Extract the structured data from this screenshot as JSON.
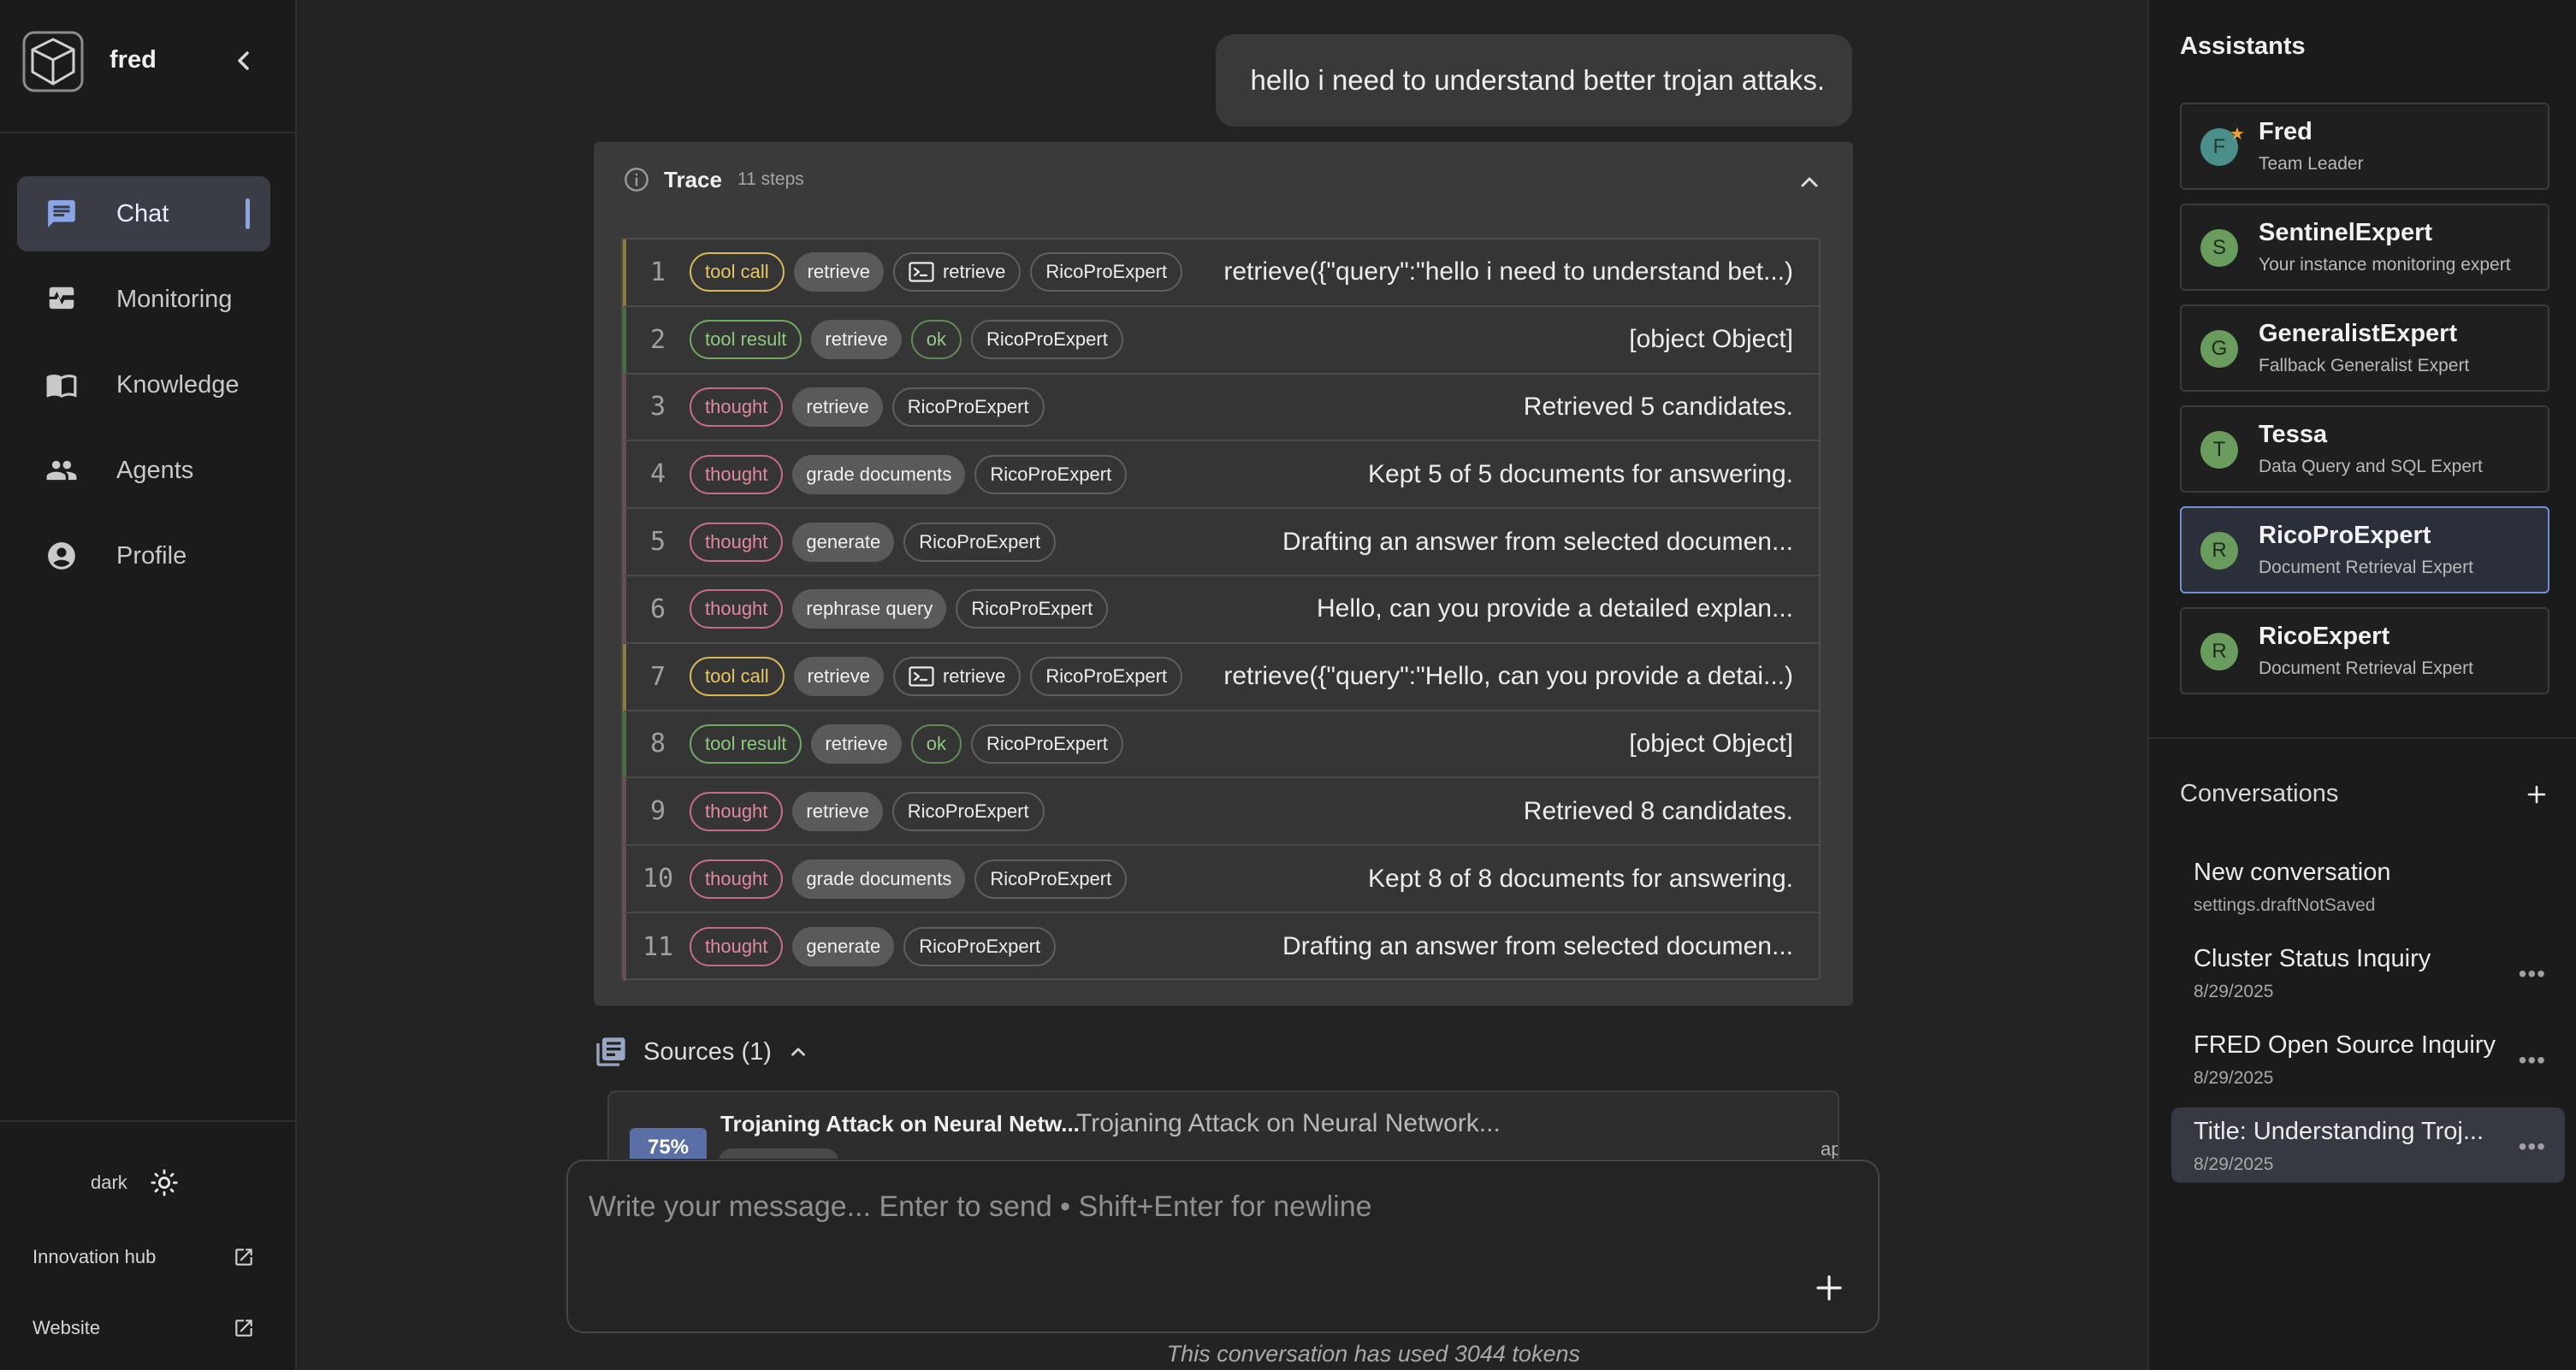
{
  "sidebar": {
    "brand": "fred",
    "nav": [
      {
        "label": "Chat",
        "icon": "chat-icon"
      },
      {
        "label": "Monitoring",
        "icon": "monitoring-icon"
      },
      {
        "label": "Knowledge",
        "icon": "book-icon"
      },
      {
        "label": "Agents",
        "icon": "people-icon"
      },
      {
        "label": "Profile",
        "icon": "account-icon"
      }
    ],
    "theme": "dark",
    "links": [
      {
        "label": "Innovation hub",
        "icon": "external-link-icon"
      },
      {
        "label": "Website",
        "icon": "external-link-icon"
      }
    ]
  },
  "chat": {
    "user_message": "hello i need to understand better trojan attaks.",
    "trace": {
      "title": "Trace",
      "steps_label": "11 steps",
      "rows": [
        {
          "n": "1",
          "kind": "tool call",
          "node": "retrieve",
          "tool": "retrieve",
          "agent": "RicoProExpert",
          "text": "retrieve({\"query\":\"hello i need to understand bet...)"
        },
        {
          "n": "2",
          "kind": "tool result",
          "node": "retrieve",
          "status": "ok",
          "agent": "RicoProExpert",
          "text": "[object Object]"
        },
        {
          "n": "3",
          "kind": "thought",
          "node": "retrieve",
          "agent": "RicoProExpert",
          "text": "Retrieved 5 candidates."
        },
        {
          "n": "4",
          "kind": "thought",
          "node": "grade documents",
          "agent": "RicoProExpert",
          "text": "Kept 5 of 5 documents for answering."
        },
        {
          "n": "5",
          "kind": "thought",
          "node": "generate",
          "agent": "RicoProExpert",
          "text": "Drafting an answer from selected documen..."
        },
        {
          "n": "6",
          "kind": "thought",
          "node": "rephrase query",
          "agent": "RicoProExpert",
          "text": "Hello, can you provide a detailed explan..."
        },
        {
          "n": "7",
          "kind": "tool call",
          "node": "retrieve",
          "tool": "retrieve",
          "agent": "RicoProExpert",
          "text": "retrieve({\"query\":\"Hello, can you provide a detai...)"
        },
        {
          "n": "8",
          "kind": "tool result",
          "node": "retrieve",
          "status": "ok",
          "agent": "RicoProExpert",
          "text": "[object Object]"
        },
        {
          "n": "9",
          "kind": "thought",
          "node": "retrieve",
          "agent": "RicoProExpert",
          "text": "Retrieved 8 candidates."
        },
        {
          "n": "10",
          "kind": "thought",
          "node": "grade documents",
          "agent": "RicoProExpert",
          "text": "Kept 8 of 8 documents for answering."
        },
        {
          "n": "11",
          "kind": "thought",
          "node": "generate",
          "agent": "RicoProExpert",
          "text": "Drafting an answer from selected documen..."
        }
      ]
    },
    "sources": {
      "label": "Sources (1)",
      "items": [
        {
          "score": "75%",
          "title": "Trojaning Attack on Neural Netw...",
          "snippet": "Trojaning Attack on Neural Network...",
          "mime": "application/pdf"
        }
      ]
    },
    "composer": {
      "placeholder": "Write your message...  Enter to send • Shift+Enter for newline"
    },
    "token_note": "This conversation has used 3044 tokens"
  },
  "right": {
    "assistants_title": "Assistants",
    "assistants": [
      {
        "initial": "F",
        "name": "Fred",
        "desc": "Team Leader"
      },
      {
        "initial": "S",
        "name": "SentinelExpert",
        "desc": "Your instance monitoring expert"
      },
      {
        "initial": "G",
        "name": "GeneralistExpert",
        "desc": "Fallback Generalist Expert"
      },
      {
        "initial": "T",
        "name": "Tessa",
        "desc": "Data Query and SQL Expert"
      },
      {
        "initial": "R",
        "name": "RicoProExpert",
        "desc": "Document Retrieval Expert"
      },
      {
        "initial": "R",
        "name": "RicoExpert",
        "desc": "Document Retrieval Expert"
      }
    ],
    "conversations_title": "Conversations",
    "conversations": [
      {
        "title": "New conversation",
        "sub": "settings.draftNotSaved"
      },
      {
        "title": "Cluster Status Inquiry",
        "sub": "8/29/2025"
      },
      {
        "title": "FRED Open Source Inquiry",
        "sub": "8/29/2025"
      },
      {
        "title": "Title: Understanding Troj...",
        "sub": "8/29/2025"
      }
    ]
  },
  "colors": {
    "accent": "#8aa4e8",
    "tool_call": "#e7c767",
    "tool_result": "#8dc97d",
    "thought": "#e08aa0",
    "score_badge": "#5a6fa6"
  }
}
